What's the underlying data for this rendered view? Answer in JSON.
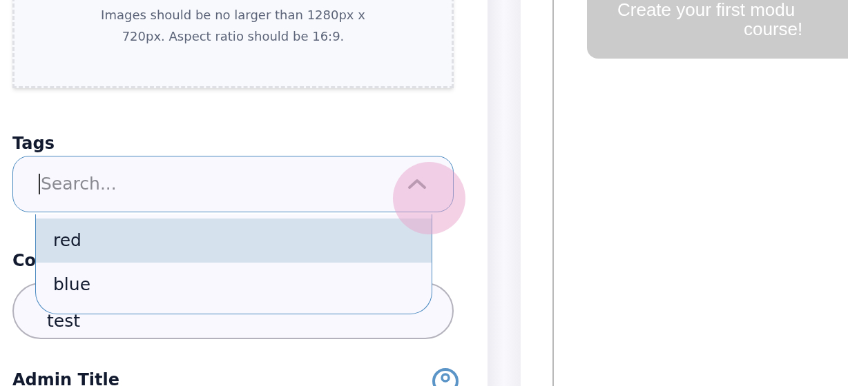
{
  "upload_box": {
    "hint": "Images should be no larger than 1280px x 720px. Aspect ratio should be 16:9."
  },
  "tags": {
    "label": "Tags",
    "placeholder": "Search...",
    "expanded": true,
    "options": [
      {
        "label": "red",
        "selected": true
      },
      {
        "label": "blue",
        "selected": false
      }
    ]
  },
  "next_field": {
    "label": "Co",
    "value": "test"
  },
  "admin_title": {
    "label": "Admin Title"
  },
  "create_module_button": {
    "lines": [
      "Create your first modu",
      "course!"
    ]
  }
}
